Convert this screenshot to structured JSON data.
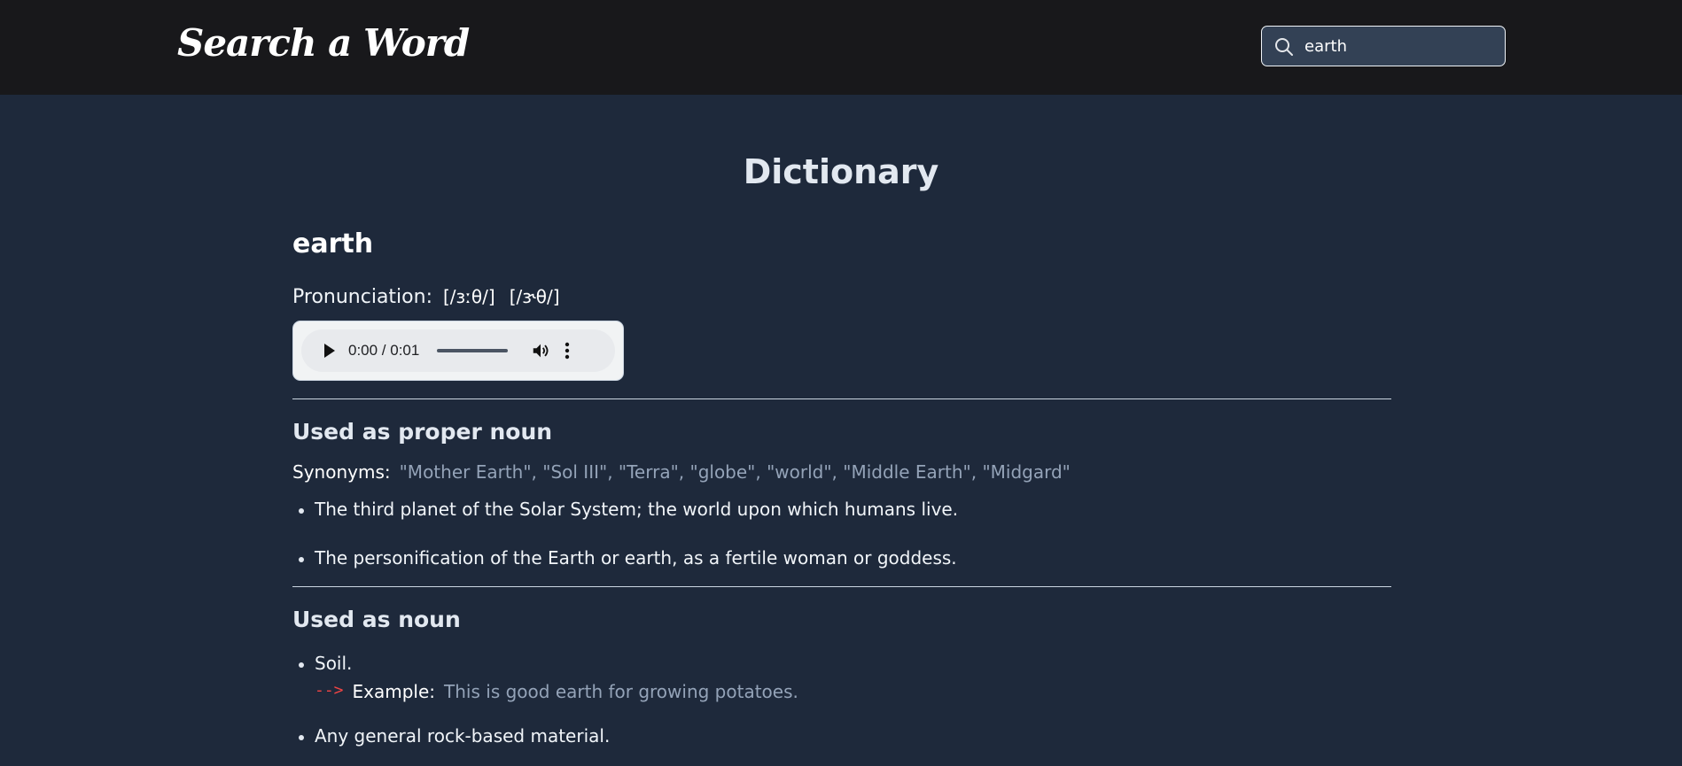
{
  "header": {
    "brand": "Search a Word",
    "search_value": "earth",
    "search_icon": "search-icon"
  },
  "main": {
    "title": "Dictionary",
    "word": "earth",
    "pronunciation_label": "Pronunciation:",
    "phonetics": [
      "[/ɜːθ/]",
      "[/ɝθ/]"
    ],
    "audio": {
      "time": "0:00 / 0:01",
      "progress": 0
    },
    "meanings": [
      {
        "heading": "Used as proper noun",
        "synonyms_label": "Synonyms:",
        "synonyms": "\"Mother Earth\", \"Sol III\", \"Terra\", \"globe\", \"world\", \"Middle Earth\", \"Midgard\"",
        "definitions": [
          "The third planet of the Solar System; the world upon which humans live.",
          "The personification of the Earth or earth, as a fertile woman or goddess."
        ]
      },
      {
        "heading": "Used as noun",
        "definitions": [
          {
            "text": "Soil.",
            "example_arrow": "-->",
            "example_label": "Example:",
            "example": "This is good earth for growing potatoes."
          },
          {
            "text": "Any general rock-based material."
          }
        ]
      }
    ]
  }
}
